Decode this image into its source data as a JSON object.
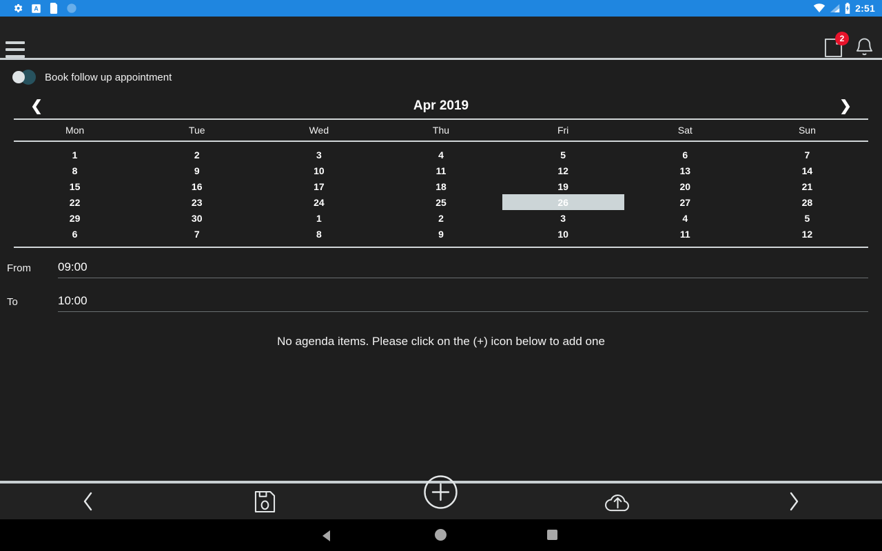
{
  "status_bar": {
    "time": "2:51",
    "left_icons": [
      "settings-gear-icon",
      "font-size-a-icon",
      "sd-card-icon",
      "translucent-circle-icon"
    ],
    "right_icons": [
      "wifi-icon",
      "cellular-signal-icon",
      "battery-charging-icon"
    ],
    "background_color": "#1f86e0"
  },
  "app_bar": {
    "menu_icon": "hamburger-menu-icon",
    "notes_icon": "note-page-icon",
    "notes_badge": "2",
    "bell_icon": "bell-notification-icon",
    "background_color": "#222222"
  },
  "follow_up": {
    "label": "Book follow up appointment",
    "enabled": false,
    "track_color": "#27525e",
    "knob_color": "#dfe4e6"
  },
  "calendar": {
    "title": "Apr 2019",
    "prev_label": "❮",
    "next_label": "❯",
    "weekdays": [
      "Mon",
      "Tue",
      "Wed",
      "Thu",
      "Fri",
      "Sat",
      "Sun"
    ],
    "selected_day": "26",
    "selected_highlight_color": "#ccd5d7",
    "weeks": [
      [
        "1",
        "2",
        "3",
        "4",
        "5",
        "6",
        "7"
      ],
      [
        "8",
        "9",
        "10",
        "11",
        "12",
        "13",
        "14"
      ],
      [
        "15",
        "16",
        "17",
        "18",
        "19",
        "20",
        "21"
      ],
      [
        "22",
        "23",
        "24",
        "25",
        "26",
        "27",
        "28"
      ],
      [
        "29",
        "30",
        "1",
        "2",
        "3",
        "4",
        "5"
      ],
      [
        "6",
        "7",
        "8",
        "9",
        "10",
        "11",
        "12"
      ]
    ]
  },
  "time_fields": {
    "from_label": "From",
    "from_value": "09:00",
    "to_label": "To",
    "to_value": "10:00"
  },
  "agenda": {
    "empty_message": "No agenda items. Please click on the (+) icon below to add one"
  },
  "toolbar": {
    "back_icon": "chevron-left-icon",
    "save_icon": "floppy-disk-save-icon",
    "add_icon": "plus-circle-add-icon",
    "upload_icon": "cloud-upload-icon",
    "forward_icon": "chevron-right-icon"
  },
  "nav_bar": {
    "back_icon": "android-back-icon",
    "home_icon": "android-home-icon",
    "recents_icon": "android-recents-icon"
  }
}
